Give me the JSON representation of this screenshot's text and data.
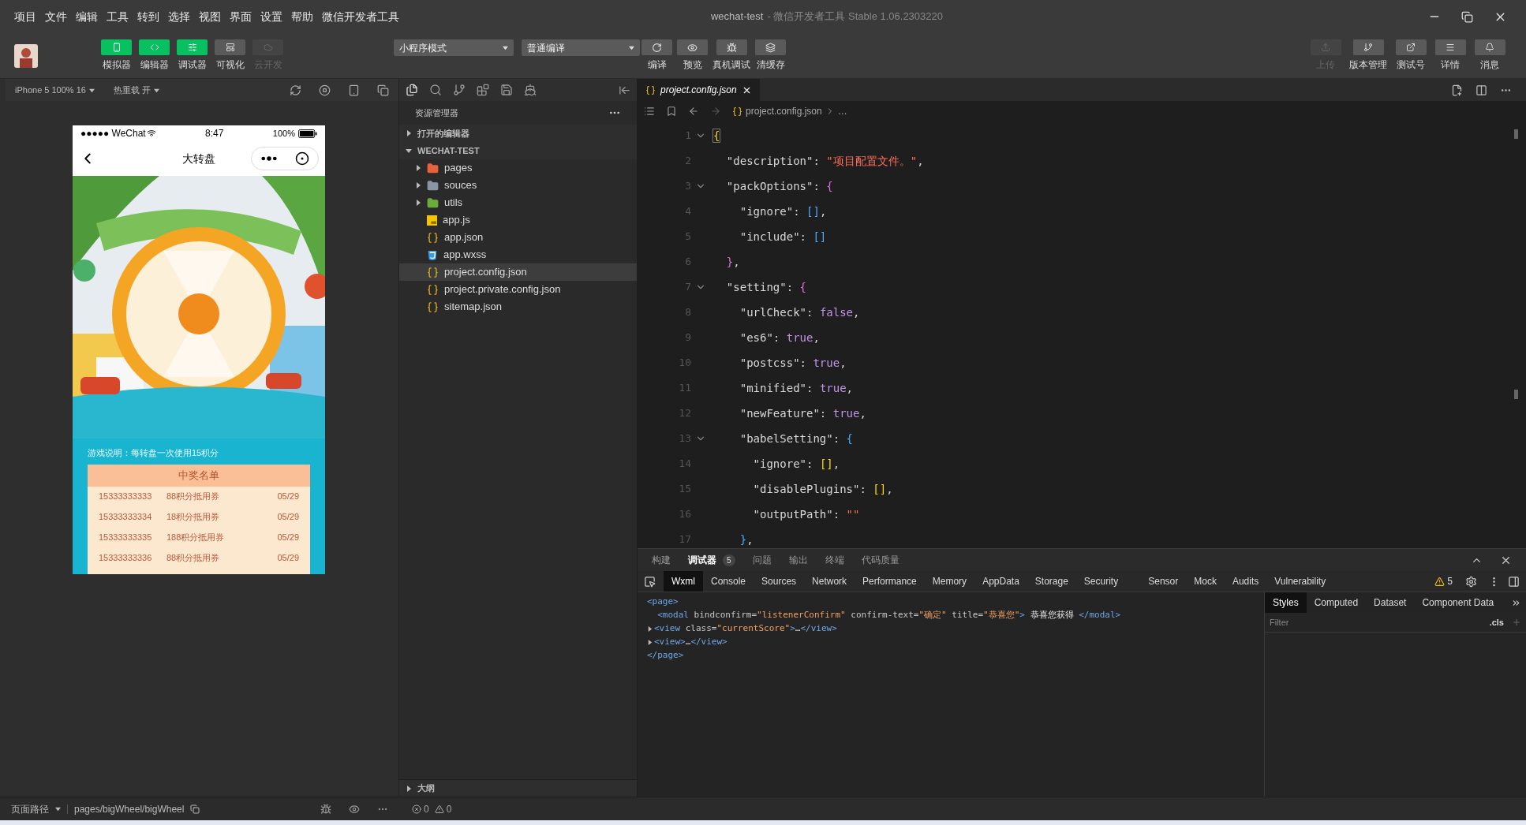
{
  "menu": [
    "项目",
    "文件",
    "编辑",
    "工具",
    "转到",
    "选择",
    "视图",
    "界面",
    "设置",
    "帮助",
    "微信开发者工具"
  ],
  "window": {
    "title": "wechat-test",
    "subtitle": "- 微信开发者工具 Stable 1.06.2303220"
  },
  "toolbar": {
    "left": [
      {
        "label": "模拟器",
        "active": true,
        "disabled": false
      },
      {
        "label": "编辑器",
        "active": true,
        "disabled": false
      },
      {
        "label": "调试器",
        "active": true,
        "disabled": false
      },
      {
        "label": "可视化",
        "active": false,
        "disabled": false
      },
      {
        "label": "云开发",
        "active": false,
        "disabled": true
      }
    ],
    "mode": "小程序模式",
    "compile": "普通编译",
    "actions": [
      {
        "label": "编译"
      },
      {
        "label": "预览"
      },
      {
        "label": "真机调试"
      },
      {
        "label": "清缓存"
      }
    ],
    "right": [
      {
        "label": "上传",
        "disabled": true
      },
      {
        "label": "版本管理",
        "disabled": false
      },
      {
        "label": "测试号",
        "disabled": false
      },
      {
        "label": "详情",
        "disabled": false
      },
      {
        "label": "消息",
        "disabled": false
      }
    ]
  },
  "simulator": {
    "device": "iPhone 5 100% 16",
    "hot_reload": "热重载 开",
    "phone": {
      "carrier": "●●●●● WeChat",
      "time": "8:47",
      "battery": "100%",
      "title": "大转盘",
      "description": "游戏说明：每转盘一次使用15积分",
      "winners": {
        "title": "中奖名单",
        "rows": [
          {
            "phone": "15333333333",
            "prize": "88积分抵用券",
            "date": "05/29"
          },
          {
            "phone": "15333333334",
            "prize": "18积分抵用券",
            "date": "05/29"
          },
          {
            "phone": "15333333335",
            "prize": "188积分抵用券",
            "date": "05/29"
          },
          {
            "phone": "15333333336",
            "prize": "88积分抵用券",
            "date": "05/29"
          }
        ]
      }
    },
    "page_path_label": "页面路径",
    "page_path": "pages/bigWheel/bigWheel"
  },
  "explorer": {
    "title": "资源管理器",
    "sections": [
      {
        "label": "打开的编辑器",
        "expanded": false
      },
      {
        "label": "WECHAT-TEST",
        "expanded": true,
        "children": [
          {
            "name": "pages",
            "kind": "folder",
            "color": "#e8623c",
            "expanded": false,
            "selected": false
          },
          {
            "name": "souces",
            "kind": "folder",
            "color": "#8a96a3",
            "expanded": false,
            "selected": false
          },
          {
            "name": "utils",
            "kind": "folder",
            "color": "#6bad3d",
            "expanded": false,
            "selected": false
          },
          {
            "name": "app.js",
            "kind": "js",
            "selected": false
          },
          {
            "name": "app.json",
            "kind": "json",
            "selected": false
          },
          {
            "name": "app.wxss",
            "kind": "wxss",
            "selected": false
          },
          {
            "name": "project.config.json",
            "kind": "json",
            "selected": true
          },
          {
            "name": "project.private.config.json",
            "kind": "json",
            "selected": false
          },
          {
            "name": "sitemap.json",
            "kind": "json",
            "selected": false
          }
        ]
      }
    ],
    "outline": "大纲",
    "errors": "0",
    "warnings": "0"
  },
  "editor": {
    "tabs": [
      {
        "label": "project.config.json",
        "selected": true
      }
    ],
    "breadcrumb": [
      "project.config.json",
      "…"
    ],
    "lines": [
      {
        "n": "1",
        "fold": true,
        "tokens": [
          {
            "t": "{",
            "kind": "b1"
          }
        ]
      },
      {
        "n": "2",
        "fold": false,
        "tokens": [
          {
            "t": "  \"description\"",
            "kind": "key"
          },
          {
            "t": ": ",
            "kind": "p"
          },
          {
            "t": "\"项目配置文件。\"",
            "kind": "str"
          },
          {
            "t": ",",
            "kind": "p"
          }
        ]
      },
      {
        "n": "3",
        "fold": true,
        "tokens": [
          {
            "t": "  \"packOptions\"",
            "kind": "key"
          },
          {
            "t": ": ",
            "kind": "p"
          },
          {
            "t": "{",
            "kind": "b2"
          }
        ]
      },
      {
        "n": "4",
        "fold": false,
        "tokens": [
          {
            "t": "    \"ignore\"",
            "kind": "key"
          },
          {
            "t": ": ",
            "kind": "p"
          },
          {
            "t": "[]",
            "kind": "b3"
          },
          {
            "t": ",",
            "kind": "p"
          }
        ]
      },
      {
        "n": "5",
        "fold": false,
        "tokens": [
          {
            "t": "    \"include\"",
            "kind": "key"
          },
          {
            "t": ": ",
            "kind": "p"
          },
          {
            "t": "[]",
            "kind": "b3"
          }
        ]
      },
      {
        "n": "6",
        "fold": false,
        "tokens": [
          {
            "t": "  }",
            "kind": "b2"
          },
          {
            "t": ",",
            "kind": "p"
          }
        ]
      },
      {
        "n": "7",
        "fold": true,
        "tokens": [
          {
            "t": "  \"setting\"",
            "kind": "key"
          },
          {
            "t": ": ",
            "kind": "p"
          },
          {
            "t": "{",
            "kind": "b2"
          }
        ]
      },
      {
        "n": "8",
        "fold": false,
        "tokens": [
          {
            "t": "    \"urlCheck\"",
            "kind": "key"
          },
          {
            "t": ": ",
            "kind": "p"
          },
          {
            "t": "false",
            "kind": "bool"
          },
          {
            "t": ",",
            "kind": "p"
          }
        ]
      },
      {
        "n": "9",
        "fold": false,
        "tokens": [
          {
            "t": "    \"es6\"",
            "kind": "key"
          },
          {
            "t": ": ",
            "kind": "p"
          },
          {
            "t": "true",
            "kind": "bool"
          },
          {
            "t": ",",
            "kind": "p"
          }
        ]
      },
      {
        "n": "10",
        "fold": false,
        "tokens": [
          {
            "t": "    \"postcss\"",
            "kind": "key"
          },
          {
            "t": ": ",
            "kind": "p"
          },
          {
            "t": "true",
            "kind": "bool"
          },
          {
            "t": ",",
            "kind": "p"
          }
        ]
      },
      {
        "n": "11",
        "fold": false,
        "tokens": [
          {
            "t": "    \"minified\"",
            "kind": "key"
          },
          {
            "t": ": ",
            "kind": "p"
          },
          {
            "t": "true",
            "kind": "bool"
          },
          {
            "t": ",",
            "kind": "p"
          }
        ]
      },
      {
        "n": "12",
        "fold": false,
        "tokens": [
          {
            "t": "    \"newFeature\"",
            "kind": "key"
          },
          {
            "t": ": ",
            "kind": "p"
          },
          {
            "t": "true",
            "kind": "bool"
          },
          {
            "t": ",",
            "kind": "p"
          }
        ]
      },
      {
        "n": "13",
        "fold": true,
        "tokens": [
          {
            "t": "    \"babelSetting\"",
            "kind": "key"
          },
          {
            "t": ": ",
            "kind": "p"
          },
          {
            "t": "{",
            "kind": "b3"
          }
        ]
      },
      {
        "n": "14",
        "fold": false,
        "tokens": [
          {
            "t": "      \"ignore\"",
            "kind": "key"
          },
          {
            "t": ": ",
            "kind": "p"
          },
          {
            "t": "[]",
            "kind": "b1"
          },
          {
            "t": ",",
            "kind": "p"
          }
        ]
      },
      {
        "n": "15",
        "fold": false,
        "tokens": [
          {
            "t": "      \"disablePlugins\"",
            "kind": "key"
          },
          {
            "t": ": ",
            "kind": "p"
          },
          {
            "t": "[]",
            "kind": "b1"
          },
          {
            "t": ",",
            "kind": "p"
          }
        ]
      },
      {
        "n": "16",
        "fold": false,
        "tokens": [
          {
            "t": "      \"outputPath\"",
            "kind": "key"
          },
          {
            "t": ": ",
            "kind": "p"
          },
          {
            "t": "\"\"",
            "kind": "str"
          }
        ]
      },
      {
        "n": "17",
        "fold": false,
        "tokens": [
          {
            "t": "    }",
            "kind": "b3"
          },
          {
            "t": ",",
            "kind": "p"
          }
        ]
      }
    ]
  },
  "panel": {
    "tabs": [
      {
        "label": "构建",
        "selected": false
      },
      {
        "label": "调试器",
        "selected": true,
        "badge": "5"
      },
      {
        "label": "问题",
        "selected": false
      },
      {
        "label": "输出",
        "selected": false
      },
      {
        "label": "终端",
        "selected": false
      },
      {
        "label": "代码质量",
        "selected": false
      }
    ],
    "devtools_tabs": [
      {
        "label": "Wxml",
        "selected": true
      },
      {
        "label": "Console",
        "selected": false
      },
      {
        "label": "Sources",
        "selected": false
      },
      {
        "label": "Network",
        "selected": false
      },
      {
        "label": "Performance",
        "selected": false
      },
      {
        "label": "Memory",
        "selected": false
      },
      {
        "label": "AppData",
        "selected": false
      },
      {
        "label": "Storage",
        "selected": false
      },
      {
        "label": "Security",
        "selected": false
      },
      {
        "label": "Sensor",
        "selected": false
      },
      {
        "label": "Mock",
        "selected": false
      },
      {
        "label": "Audits",
        "selected": false
      },
      {
        "label": "Vulnerability",
        "selected": false
      }
    ],
    "warning_count": "5",
    "wxml": [
      {
        "expandable": false,
        "tokens": [
          {
            "t": "<page>",
            "kind": "tag"
          }
        ]
      },
      {
        "expandable": false,
        "tokens": [
          {
            "t": "  <modal ",
            "kind": "tag"
          },
          {
            "t": "bindconfirm=",
            "kind": "attr"
          },
          {
            "t": "\"listenerConfirm\"",
            "kind": "val"
          },
          {
            "t": " confirm-text=",
            "kind": "attr"
          },
          {
            "t": "\"确定\"",
            "kind": "val"
          },
          {
            "t": " title=",
            "kind": "attr"
          },
          {
            "t": "\"恭喜您\"",
            "kind": "val"
          },
          {
            "t": ">",
            "kind": "tag"
          },
          {
            "t": " 恭喜您获得 ",
            "kind": "text"
          },
          {
            "t": "</modal>",
            "kind": "tag"
          }
        ]
      },
      {
        "expandable": true,
        "tokens": [
          {
            "t": "<view ",
            "kind": "tag"
          },
          {
            "t": "class=",
            "kind": "attr"
          },
          {
            "t": "\"currentScore\"",
            "kind": "val"
          },
          {
            "t": ">",
            "kind": "tag"
          },
          {
            "t": "…",
            "kind": "text"
          },
          {
            "t": "</view>",
            "kind": "tag"
          }
        ]
      },
      {
        "expandable": true,
        "tokens": [
          {
            "t": "<view>",
            "kind": "tag"
          },
          {
            "t": "…",
            "kind": "text"
          },
          {
            "t": "</view>",
            "kind": "tag"
          }
        ]
      },
      {
        "expandable": false,
        "tokens": [
          {
            "t": "</page>",
            "kind": "tag"
          }
        ]
      }
    ],
    "style_tabs": [
      {
        "label": "Styles",
        "selected": true
      },
      {
        "label": "Computed",
        "selected": false
      },
      {
        "label": "Dataset",
        "selected": false
      },
      {
        "label": "Component Data",
        "selected": false
      }
    ],
    "filter_placeholder": "Filter",
    "cls": ".cls"
  }
}
